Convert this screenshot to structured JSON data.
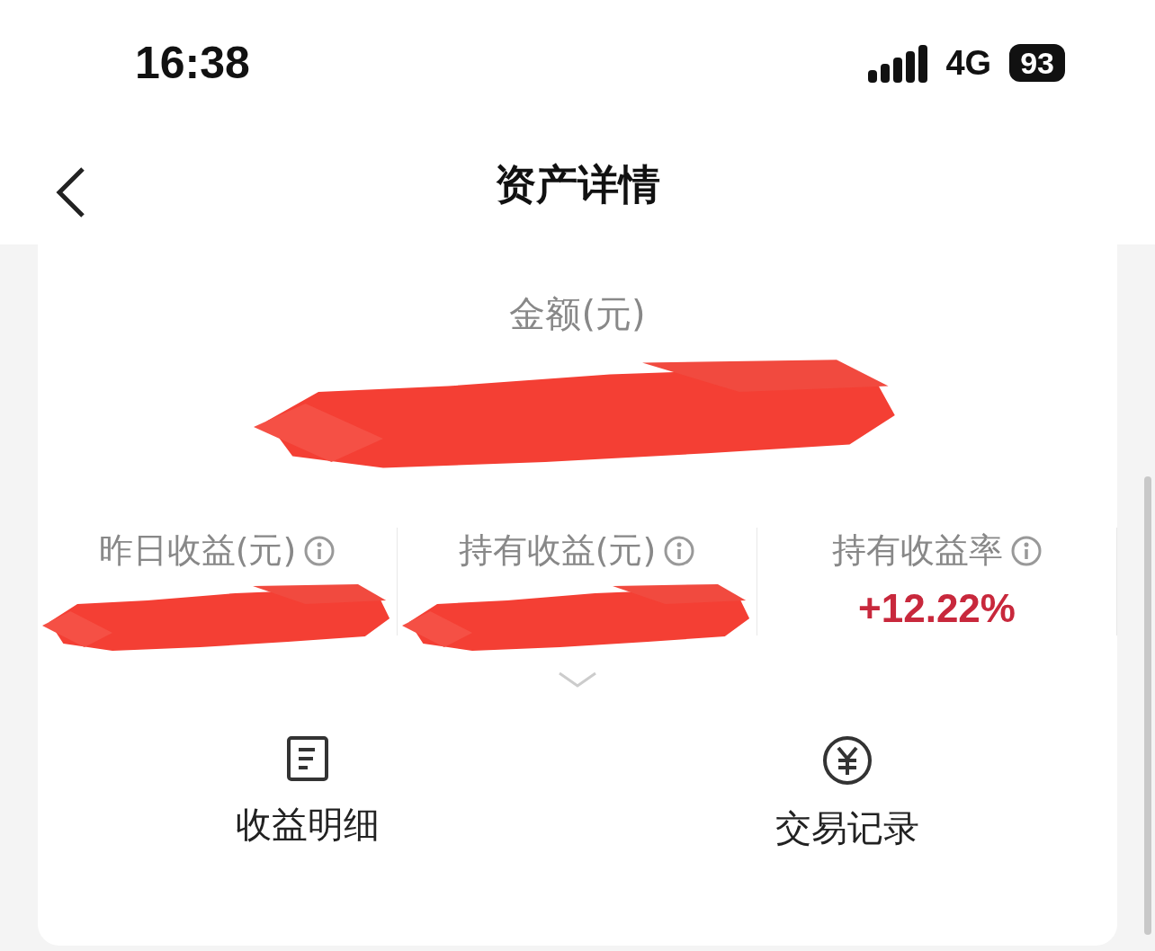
{
  "status_bar": {
    "time": "16:38",
    "network": "4G",
    "battery": "93"
  },
  "nav": {
    "title": "资产详情"
  },
  "amount": {
    "label": "金额(元)",
    "redacted": true
  },
  "metrics": [
    {
      "label": "昨日收益(元)",
      "redacted": true
    },
    {
      "label": "持有收益(元)",
      "redacted": true
    },
    {
      "label": "持有收益率",
      "value": "+12.22%",
      "redacted": false
    }
  ],
  "actions": [
    {
      "label": "收益明细",
      "kind": "document"
    },
    {
      "label": "交易记录",
      "kind": "yen"
    }
  ]
}
